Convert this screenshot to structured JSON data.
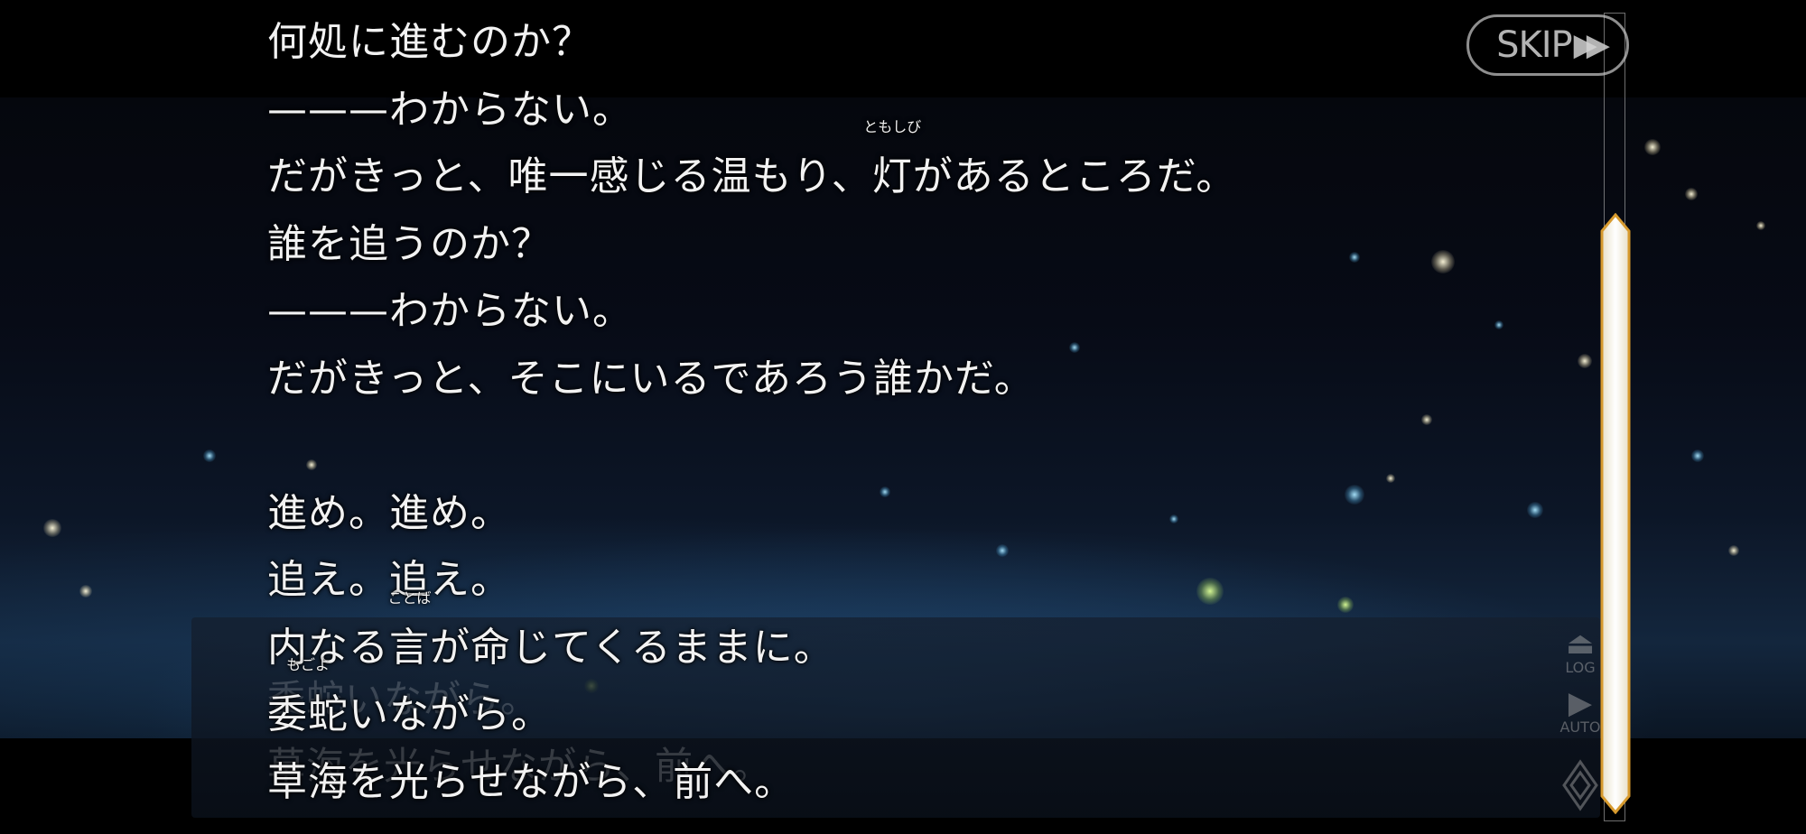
{
  "skip_button": {
    "label": "SKIP",
    "icon": "fast-forward-icon"
  },
  "controls": {
    "log_label": "LOG",
    "auto_label": "AUTO",
    "log_icon": "eject-icon",
    "auto_icon": "play-icon",
    "menu_icon": "diamond-icon"
  },
  "backlog": {
    "lines": [
      {
        "text": "何処に進むのか？"
      },
      {
        "text": "———わからない。"
      },
      {
        "before": "だがきっと、唯一感じる温もり、",
        "ruby_base": "灯",
        "ruby_text": "ともしび",
        "after": "があるところだ。"
      },
      {
        "text": "誰を追うのか？"
      },
      {
        "text": "———わからない。"
      },
      {
        "text": "だがきっと、そこにいるであろう誰かだ。"
      },
      {
        "text": ""
      },
      {
        "text": "進め。進め。"
      },
      {
        "text": "追え。追え。"
      },
      {
        "before": "内なる",
        "ruby_base": "言",
        "ruby_text": "ことば",
        "after": "が命じてくるままに。"
      },
      {
        "before": "",
        "ruby_base": "委蛇",
        "ruby_text": "もごよ",
        "after": "いながら。"
      },
      {
        "text": "草海を光らせながら、前へ。"
      }
    ]
  },
  "message_window": {
    "line1": "委蛇いながら。",
    "line2": "草海を光らせながら、前へ。"
  },
  "scrollbar": {
    "position": 1.0
  }
}
